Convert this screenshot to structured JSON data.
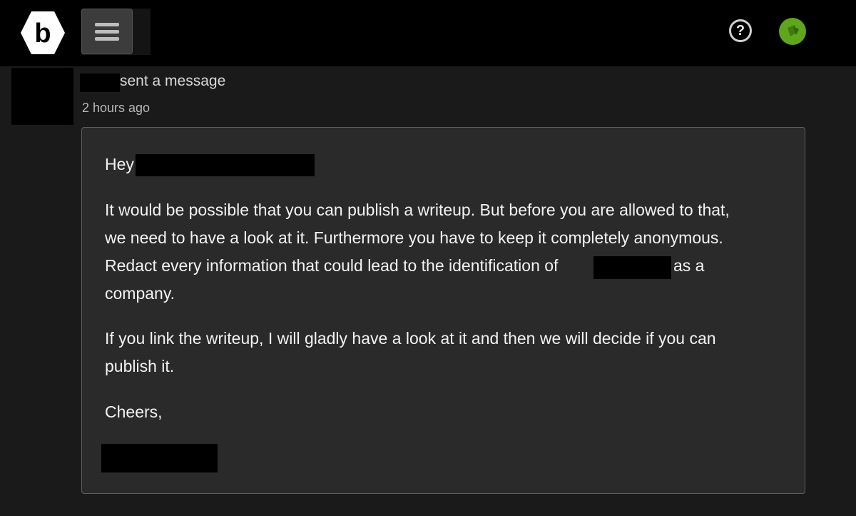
{
  "header": {
    "logo_letter": "b",
    "help_label": "?",
    "icons": {
      "logo": "hexagon-b-logo",
      "menu": "hamburger-menu-icon",
      "help": "help-circle-icon",
      "user": "user-avatar"
    },
    "colors": {
      "topbar": "#000000",
      "avatar": "#5ea61a"
    }
  },
  "notification": {
    "sender_redacted": true,
    "action_text": "sent a message",
    "time": "2 hours ago"
  },
  "message": {
    "greeting": "Hey",
    "p1_l1": "It would be possible that you can publish a writeup. But before you are allowed to that,",
    "p1_l2": "we need to have a look at it. Furthermore you have to keep it completely anonymous.",
    "p1_l3a": "Redact every information that could lead to the identification of",
    "p1_l3b": "as a",
    "p1_l4": "company.",
    "p2_l1": "If you link the writeup, I will gladly have a look at it and then we will decide if you can",
    "p2_l2": "publish it.",
    "signoff": "Cheers,"
  }
}
